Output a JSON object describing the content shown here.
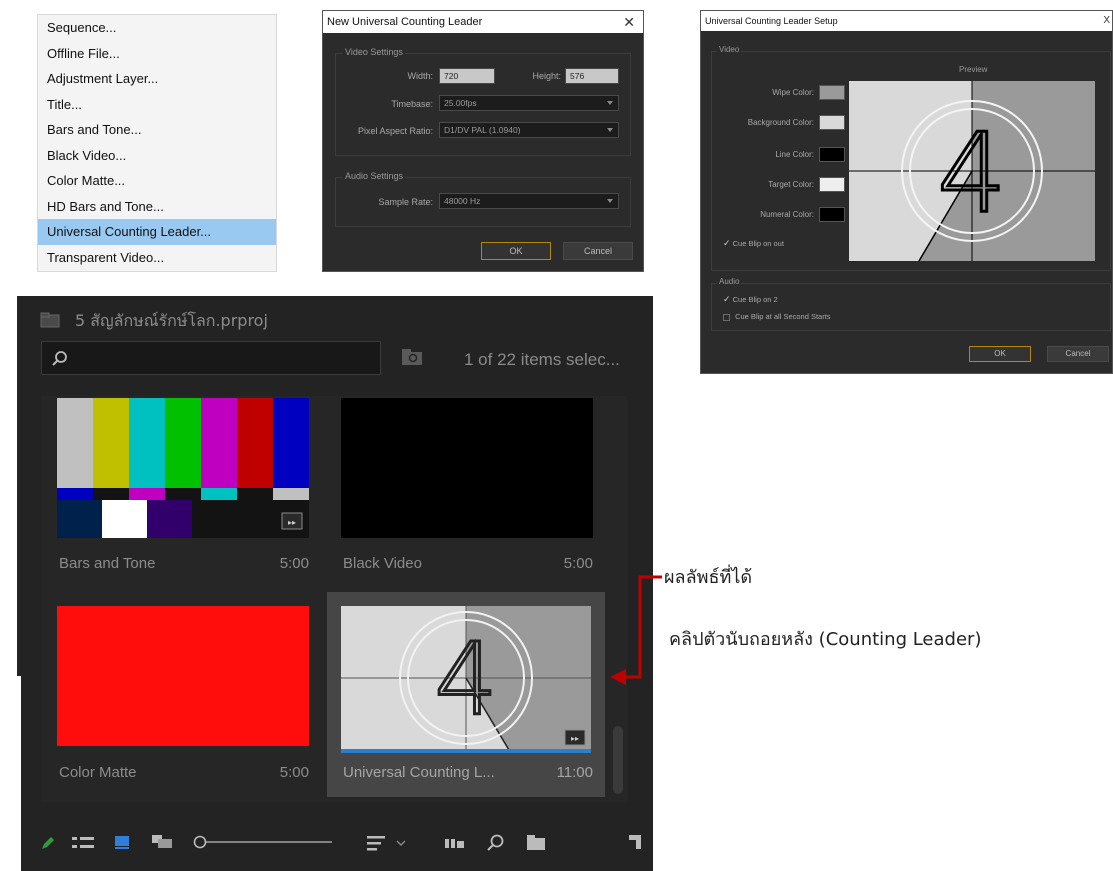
{
  "menu": {
    "items": [
      "Sequence...",
      "Offline File...",
      "Adjustment Layer...",
      "Title...",
      "Bars and Tone...",
      "Black Video...",
      "Color Matte...",
      "HD Bars and Tone...",
      "Universal Counting Leader...",
      "Transparent Video..."
    ],
    "selected_index": 8
  },
  "new_leader_dialog": {
    "title": "New Universal Counting Leader",
    "close": "✕",
    "video_group": "Video Settings",
    "width_label": "Width:",
    "width_value": "720",
    "height_label": "Height:",
    "height_value": "576",
    "timebase_label": "Timebase:",
    "timebase_value": "25.00fps",
    "par_label": "Pixel Aspect Ratio:",
    "par_value": "D1/DV PAL (1.0940)",
    "audio_group": "Audio Settings",
    "sample_rate_label": "Sample Rate:",
    "sample_rate_value": "48000 Hz",
    "ok": "OK",
    "cancel": "Cancel"
  },
  "setup_dialog": {
    "title": "Universal Counting Leader Setup",
    "close": "X",
    "video_group": "Video",
    "preview_label": "Preview",
    "wipe_label": "Wipe Color:",
    "background_label": "Background Color:",
    "line_label": "Line Color:",
    "target_label": "Target Color:",
    "numeral_label": "Numeral Color:",
    "cue_blip_out": "Cue Blip on out",
    "audio_group": "Audio",
    "cue_blip_2": "Cue Blip on 2",
    "cue_blip_all": "Cue Blip at all Second Starts",
    "ok": "OK",
    "cancel": "Cancel",
    "preview_numeral": "4",
    "colors": {
      "wipe": "#9a9a9a",
      "background": "#d9d9d9",
      "line": "#000000",
      "target": "#eeeeee",
      "numeral": "#000000"
    }
  },
  "project_panel": {
    "project_name": "5 สัญลักษณ์รักษ์โลก.prproj",
    "selection_count": "1 of 22 items selec...",
    "tiles": [
      {
        "name": "Bars and Tone",
        "duration": "5:00"
      },
      {
        "name": "Black Video",
        "duration": "5:00"
      },
      {
        "name": "Color Matte",
        "duration": "5:00"
      },
      {
        "name": "Universal Counting L...",
        "duration": "11:00"
      }
    ],
    "leader_numeral": "4"
  },
  "annotations": {
    "result": "ผลลัพธ์ที่ได้",
    "description": "คลิปตัวนับถอยหลัง (Counting Leader)"
  },
  "colors": {
    "accent_red": "#c00000",
    "menu_highlight": "#99c9f1",
    "matte_red": "#ff0d0d"
  }
}
